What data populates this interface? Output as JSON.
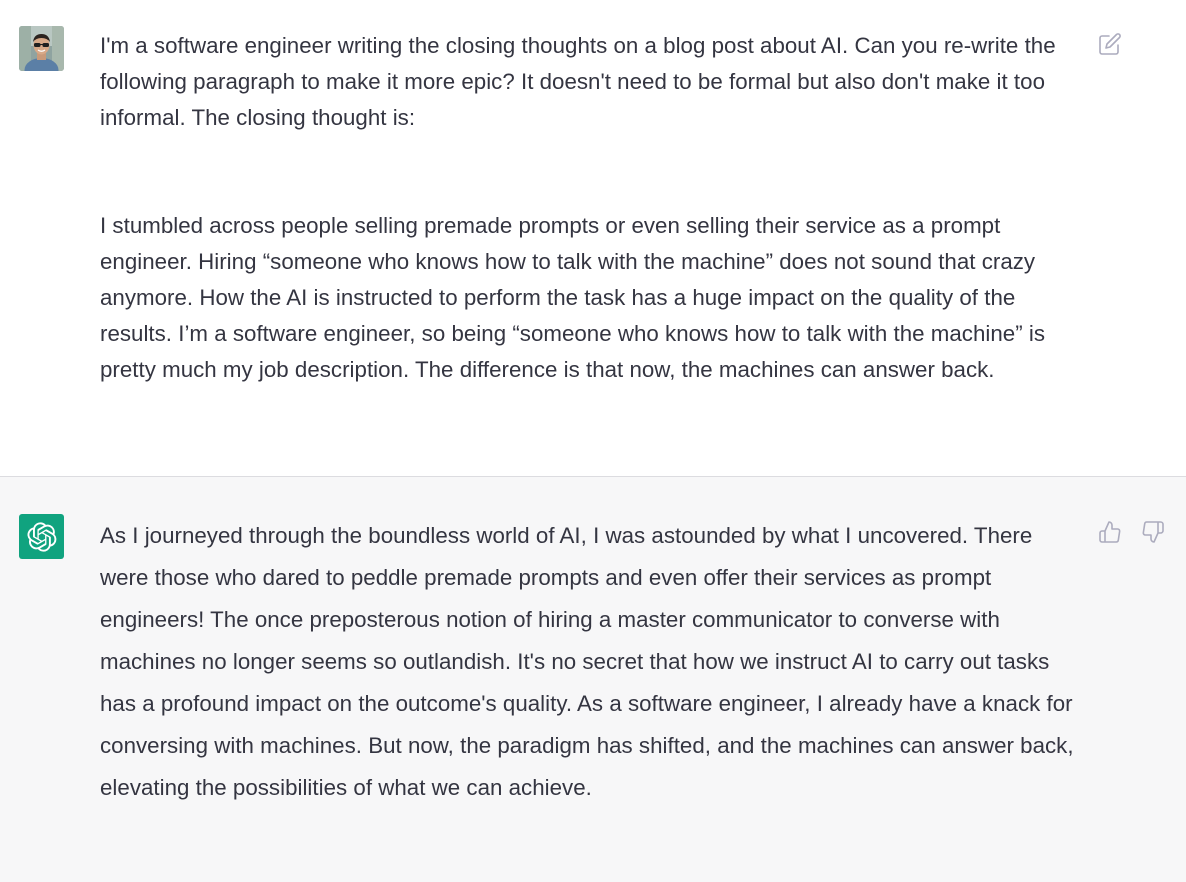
{
  "conversation": {
    "user_message": {
      "avatar": "user-avatar-photo",
      "paragraph_1": "I'm a software engineer writing the closing thoughts on a blog post about AI. Can you re-write the following paragraph to make it more epic? It doesn't need to be formal but also don't make it too informal. The closing thought is:",
      "paragraph_2": "I stumbled across people selling premade prompts or even selling their service as a prompt engineer. Hiring “someone who knows how to talk with the machine” does not sound that crazy anymore. How the AI is instructed to perform the task has a huge impact on the quality of the results. I’m a software engineer, so being “someone who knows how to talk with the machine” is pretty much my job description. The difference is that now, the machines can answer back.",
      "edit_icon": "edit-icon"
    },
    "assistant_message": {
      "avatar": "openai-logo-icon",
      "avatar_color": "#10a37f",
      "text": "As I journeyed through the boundless world of AI, I was astounded by what I uncovered. There were those who dared to peddle premade prompts and even offer their services as prompt engineers! The once preposterous notion of hiring a master communicator to converse with machines no longer seems so outlandish. It's no secret that how we instruct AI to carry out tasks has a profound impact on the outcome's quality. As a software engineer, I already have a knack for conversing with machines. But now, the paradigm has shifted, and the machines can answer back, elevating the possibilities of what we can achieve.",
      "thumbs_up_icon": "thumbs-up-icon",
      "thumbs_down_icon": "thumbs-down-icon"
    },
    "colors": {
      "text": "#343541",
      "assistant_bg": "#f7f7f8",
      "icon": "#acacbe"
    }
  }
}
